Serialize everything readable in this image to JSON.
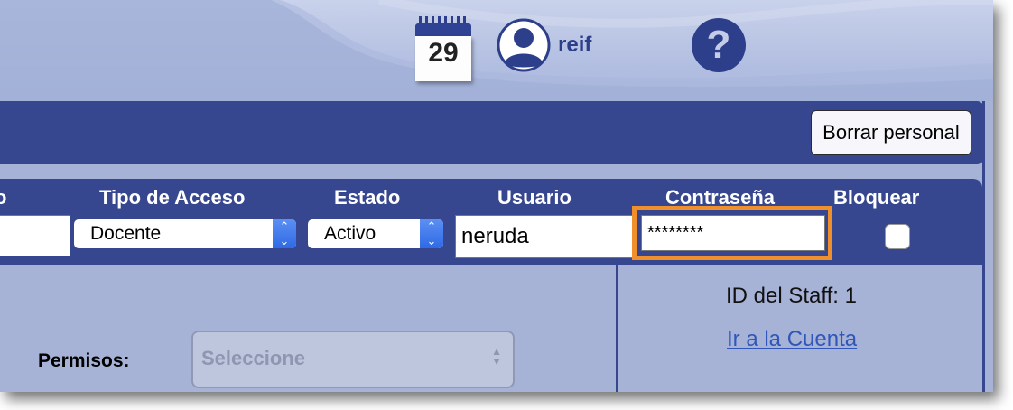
{
  "header": {
    "calendar_day": "29",
    "user_name": "reif",
    "icons": [
      "calendar-icon",
      "user-avatar-icon",
      "help-icon"
    ]
  },
  "toolbar": {
    "delete_staff_label": "Borrar personal"
  },
  "fields": {
    "headers": {
      "access_type": "Tipo de Acceso",
      "status": "Estado",
      "username": "Usuario",
      "password": "Contraseña",
      "block": "Bloquear",
      "partial": "o"
    },
    "left_value": "",
    "access_type_value": "Docente",
    "status_value": "Activo",
    "username_value": "neruda",
    "password_value": "********",
    "block_checked": false
  },
  "details": {
    "staff_id": "ID del Staff: 1",
    "account_link": "Ir a la Cuenta"
  },
  "permissions": {
    "label": "Permisos:",
    "placeholder": "Seleccione"
  },
  "colors": {
    "band": "#36468f",
    "background": "#a6b3d6",
    "highlight": "#f0902d",
    "link": "#2f56b8"
  }
}
